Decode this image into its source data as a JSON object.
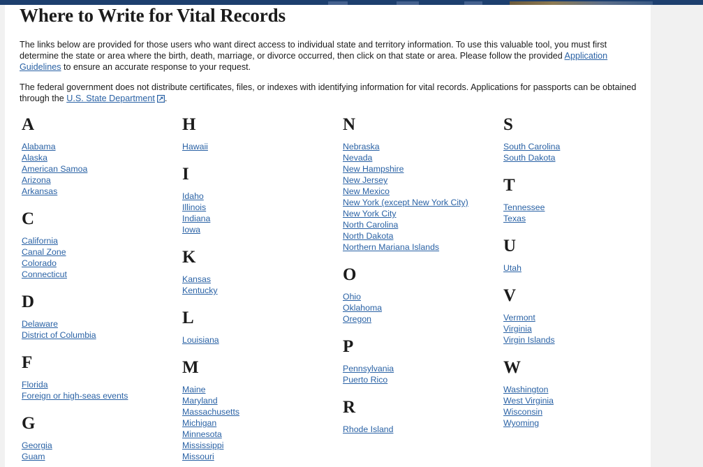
{
  "page": {
    "title": "Where to Write for Vital Records",
    "intro_paragraph_1_part_1": "The links below are provided for those users who want direct access to individual state and territory information. To use this valuable tool, you must first determine the state or area where the birth, death, marriage, or divorce occurred, then click on that state or area. Please follow the provided ",
    "intro_paragraph_1_link": "Application Guidelines",
    "intro_paragraph_1_part_2": " to ensure an accurate response to your request.",
    "intro_paragraph_2_part_1": "The federal government does not distribute certificates, files, or indexes with identifying information for vital records. Applications for passports can be obtained through the ",
    "intro_paragraph_2_link": "U.S. State Department",
    "intro_paragraph_2_icon": "external-link-icon",
    "intro_paragraph_2_part_2": "."
  },
  "colors": {
    "link": "#2a62a5",
    "text": "#1b1b1b",
    "navbar": "#1d3f6e",
    "page_background": "#f1f1f1",
    "content_background": "#ffffff"
  },
  "columns": [
    {
      "groups": [
        {
          "letter": "A",
          "states": [
            "Alabama",
            "Alaska",
            "American Samoa",
            "Arizona",
            "Arkansas"
          ]
        },
        {
          "letter": "C",
          "states": [
            "California",
            "Canal Zone",
            "Colorado",
            "Connecticut"
          ]
        },
        {
          "letter": "D",
          "states": [
            "Delaware",
            "District of Columbia"
          ]
        },
        {
          "letter": "F",
          "states": [
            "Florida",
            "Foreign or high-seas events"
          ]
        },
        {
          "letter": "G",
          "states": [
            "Georgia",
            "Guam"
          ]
        }
      ]
    },
    {
      "groups": [
        {
          "letter": "H",
          "states": [
            "Hawaii"
          ]
        },
        {
          "letter": "I",
          "states": [
            "Idaho",
            "Illinois",
            "Indiana",
            "Iowa"
          ]
        },
        {
          "letter": "K",
          "states": [
            "Kansas",
            "Kentucky"
          ]
        },
        {
          "letter": "L",
          "states": [
            "Louisiana"
          ]
        },
        {
          "letter": "M",
          "states": [
            "Maine",
            "Maryland",
            "Massachusetts",
            "Michigan",
            "Minnesota",
            "Mississippi",
            "Missouri"
          ]
        }
      ]
    },
    {
      "groups": [
        {
          "letter": "N",
          "states": [
            "Nebraska",
            "Nevada",
            "New Hampshire",
            "New Jersey",
            "New Mexico",
            "New York (except New York City)",
            "New York City",
            "North Carolina",
            "North Dakota",
            "Northern Mariana Islands"
          ]
        },
        {
          "letter": "O",
          "states": [
            "Ohio",
            "Oklahoma",
            "Oregon"
          ]
        },
        {
          "letter": "P",
          "states": [
            "Pennsylvania",
            "Puerto Rico"
          ]
        },
        {
          "letter": "R",
          "states": [
            "Rhode Island"
          ]
        }
      ]
    },
    {
      "groups": [
        {
          "letter": "S",
          "states": [
            "South Carolina",
            "South Dakota"
          ]
        },
        {
          "letter": "T",
          "states": [
            "Tennessee",
            "Texas"
          ]
        },
        {
          "letter": "U",
          "states": [
            "Utah"
          ]
        },
        {
          "letter": "V",
          "states": [
            "Vermont",
            "Virginia",
            "Virgin Islands"
          ]
        },
        {
          "letter": "W",
          "states": [
            "Washington",
            "West Virginia",
            "Wisconsin",
            "Wyoming"
          ]
        }
      ]
    }
  ]
}
